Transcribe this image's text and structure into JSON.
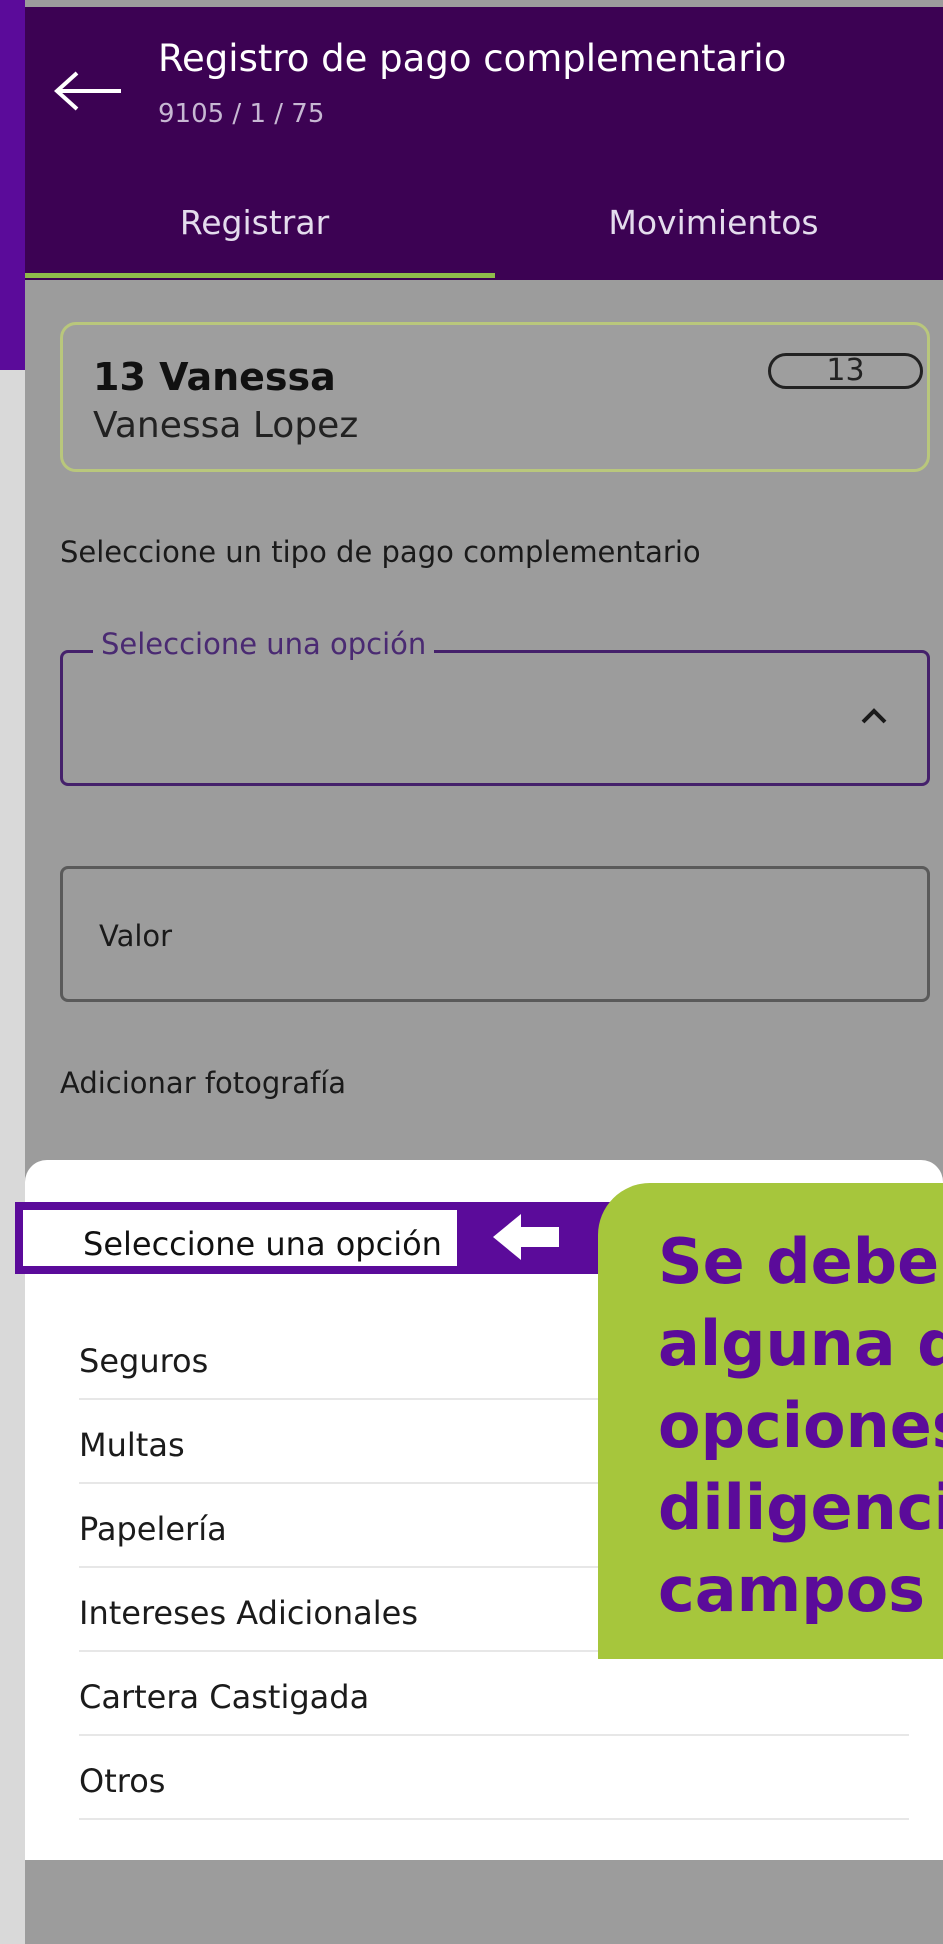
{
  "header": {
    "title": "Registro de pago complementario",
    "subtitle": "9105 / 1 / 75",
    "back_icon": "arrow-left-icon"
  },
  "tabs": [
    {
      "label": "Registrar",
      "active": true
    },
    {
      "label": "Movimientos",
      "active": false
    }
  ],
  "client_card": {
    "name": "13 Vanessa",
    "full_name": "Vanessa Lopez",
    "badge": "13"
  },
  "form": {
    "type_label": "Seleccione un tipo de pago complementario",
    "select_placeholder": "Seleccione una opción",
    "select_icon": "chevron-up-icon",
    "value_label": "Valor",
    "photo_label": "Adicionar fotografía"
  },
  "sheet": {
    "selected_option": "Seleccione una opción",
    "options": [
      "Seguros",
      "Multas",
      "Papelería",
      "Intereses Adicionales",
      "Cartera Castigada",
      "Otros"
    ]
  },
  "annotation": {
    "text": "Se debe e\nalguna d\nopciones\ndiligenci\ncampos",
    "arrow_icon": "arrow-left-icon"
  },
  "colors": {
    "purple": "#5b0b9a",
    "header": "#3c0253",
    "accent_green": "#a6c63c",
    "tab_underline": "#8fbb4b"
  }
}
